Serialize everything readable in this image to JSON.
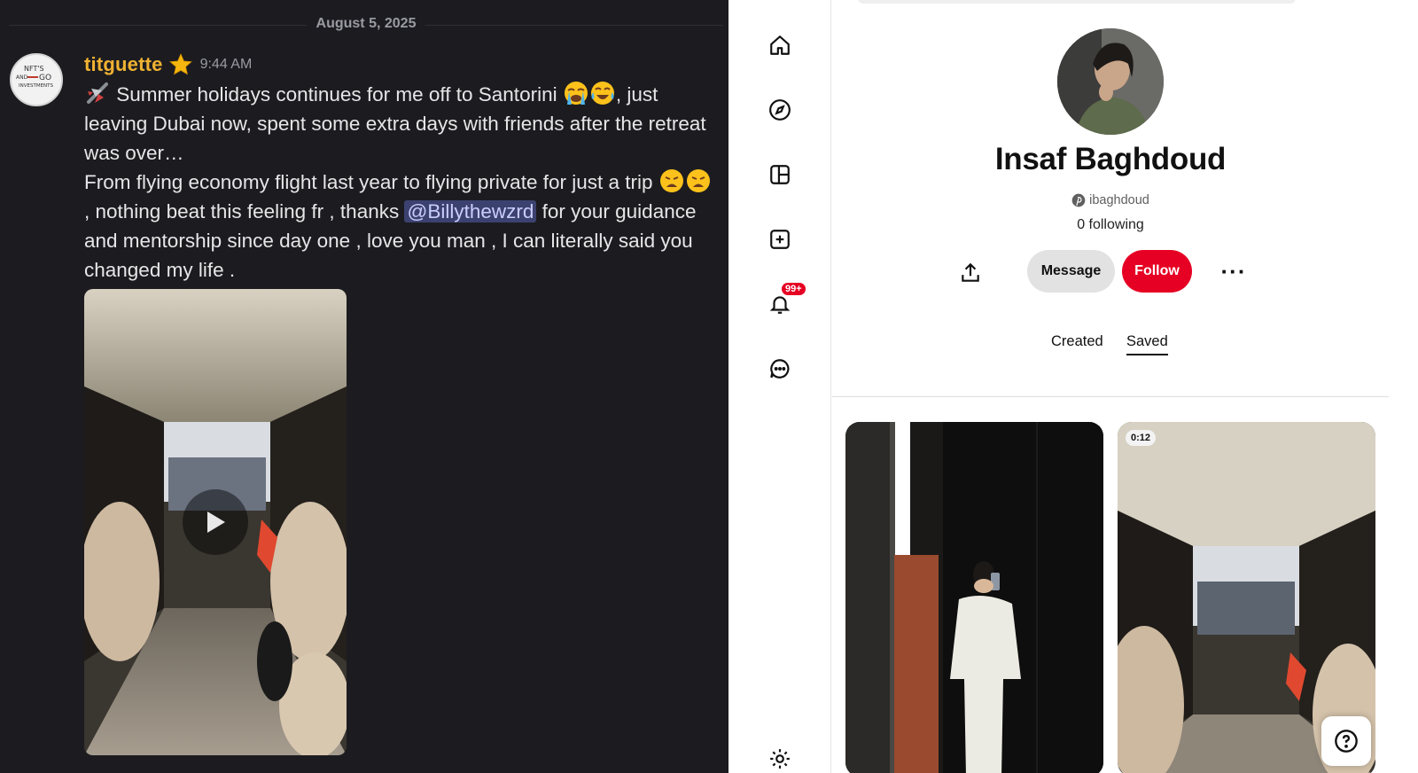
{
  "discord": {
    "date_divider": "August 5, 2025",
    "message": {
      "username": "titguette",
      "timestamp": "9:44 AM",
      "avatar_text": [
        "NFT'S",
        "AND",
        "GO",
        "INVESTMENTS"
      ],
      "lines": {
        "l1a": " Summer holidays continues for me off to Santorini ",
        "l1b": ", just leaving Dubai now, spent some extra days with friends after the retreat was over…",
        "l2a": "From flying economy flight last year to flying private for just a trip ",
        "l2b": ", nothing beat this feeling fr , thanks ",
        "mention": "@Billythewzrd",
        "l2c": " for your guidance and mentorship since day one , love you man , I can literally said you changed my life ."
      },
      "emojis": [
        "airplane-emoji",
        "loudly-crying-emoji",
        "tears-of-joy-emoji",
        "weary-face-emoji",
        "weary-face-emoji"
      ],
      "attachment": {
        "type": "video",
        "icon": "play-icon"
      }
    }
  },
  "pinterest": {
    "rail_icons": [
      "home-icon",
      "explore-compass-icon",
      "boards-icon",
      "create-plus-icon",
      "notifications-bell-icon",
      "messages-icon",
      "settings-gear-icon"
    ],
    "notifications_badge": "99+",
    "profile": {
      "name": "Insaf Baghdoud",
      "handle": "ibaghdoud",
      "following": "0 following",
      "message_label": "Message",
      "follow_label": "Follow",
      "more_label": "···"
    },
    "tabs": [
      {
        "label": "Created",
        "active": false
      },
      {
        "label": "Saved",
        "active": true
      }
    ],
    "pins": [
      {
        "type": "image",
        "description": "mirror-selfie"
      },
      {
        "type": "video",
        "duration": "0:12"
      }
    ],
    "help_icon": "question-mark-icon"
  },
  "colors": {
    "discord_bg": "#1c1c20",
    "discord_username": "#f0b232",
    "mention_bg": "#3c4270",
    "pinterest_red": "#e60023"
  }
}
